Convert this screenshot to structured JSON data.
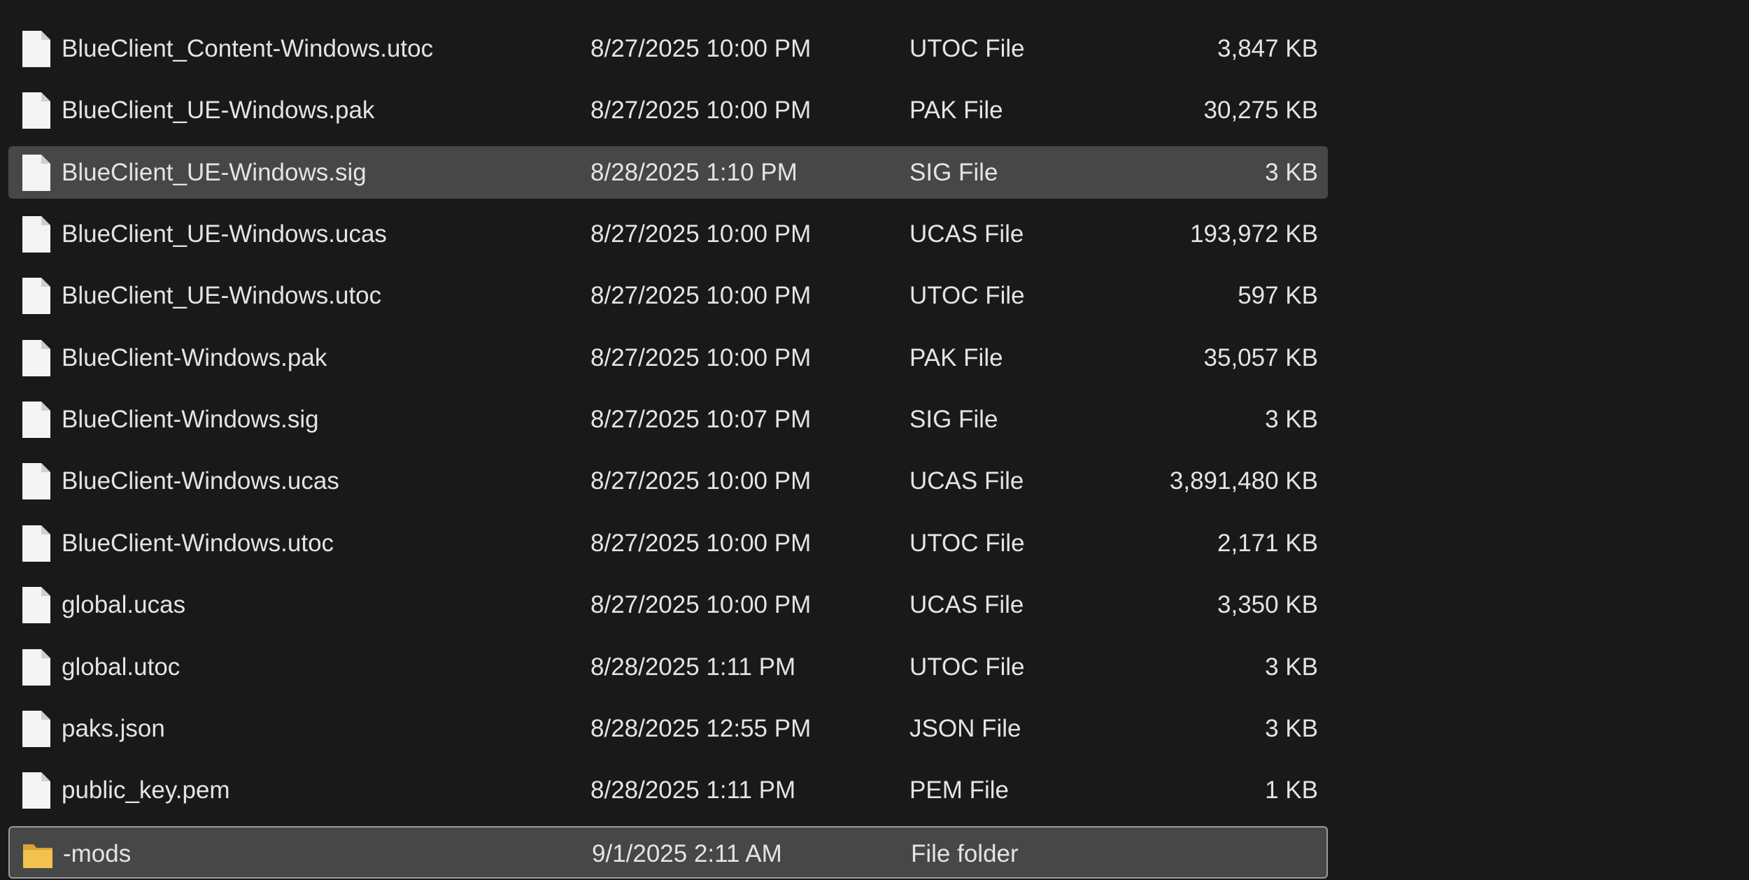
{
  "files": [
    {
      "name": "BlueClient_Content-Windows.utoc",
      "date": "8/27/2025 10:00 PM",
      "type": "UTOC File",
      "size": "3,847 KB",
      "icon": "file-icon",
      "state": "normal"
    },
    {
      "name": "BlueClient_UE-Windows.pak",
      "date": "8/27/2025 10:00 PM",
      "type": "PAK File",
      "size": "30,275 KB",
      "icon": "file-icon",
      "state": "normal"
    },
    {
      "name": "BlueClient_UE-Windows.sig",
      "date": "8/28/2025 1:10 PM",
      "type": "SIG File",
      "size": "3 KB",
      "icon": "file-icon",
      "state": "selected"
    },
    {
      "name": "BlueClient_UE-Windows.ucas",
      "date": "8/27/2025 10:00 PM",
      "type": "UCAS File",
      "size": "193,972 KB",
      "icon": "file-icon",
      "state": "normal"
    },
    {
      "name": "BlueClient_UE-Windows.utoc",
      "date": "8/27/2025 10:00 PM",
      "type": "UTOC File",
      "size": "597 KB",
      "icon": "file-icon",
      "state": "normal"
    },
    {
      "name": "BlueClient-Windows.pak",
      "date": "8/27/2025 10:00 PM",
      "type": "PAK File",
      "size": "35,057 KB",
      "icon": "file-icon",
      "state": "normal"
    },
    {
      "name": "BlueClient-Windows.sig",
      "date": "8/27/2025 10:07 PM",
      "type": "SIG File",
      "size": "3 KB",
      "icon": "file-icon",
      "state": "normal"
    },
    {
      "name": "BlueClient-Windows.ucas",
      "date": "8/27/2025 10:00 PM",
      "type": "UCAS File",
      "size": "3,891,480 KB",
      "icon": "file-icon",
      "state": "normal"
    },
    {
      "name": "BlueClient-Windows.utoc",
      "date": "8/27/2025 10:00 PM",
      "type": "UTOC File",
      "size": "2,171 KB",
      "icon": "file-icon",
      "state": "normal"
    },
    {
      "name": "global.ucas",
      "date": "8/27/2025 10:00 PM",
      "type": "UCAS File",
      "size": "3,350 KB",
      "icon": "file-icon",
      "state": "normal"
    },
    {
      "name": "global.utoc",
      "date": "8/28/2025 1:11 PM",
      "type": "UTOC File",
      "size": "3 KB",
      "icon": "file-icon",
      "state": "normal"
    },
    {
      "name": "paks.json",
      "date": "8/28/2025 12:55 PM",
      "type": "JSON File",
      "size": "3 KB",
      "icon": "file-icon",
      "state": "normal"
    },
    {
      "name": "public_key.pem",
      "date": "8/28/2025 1:11 PM",
      "type": "PEM File",
      "size": "1 KB",
      "icon": "file-icon",
      "state": "normal"
    },
    {
      "name": "-mods",
      "date": "9/1/2025 2:11 AM",
      "type": "File folder",
      "size": "",
      "icon": "folder-icon",
      "state": "focused"
    }
  ],
  "colors": {
    "background": "#191919",
    "text": "#e4e4e4",
    "selected_row": "#474747",
    "focus_border": "#9a9a9a",
    "folder": "#f2c14e"
  }
}
